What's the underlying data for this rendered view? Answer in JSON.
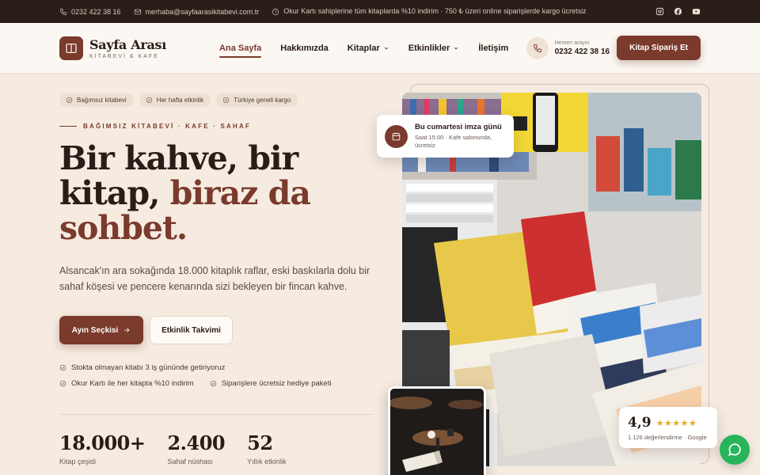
{
  "topbar": {
    "phone": "0232 422 38 16",
    "email": "merhaba@sayfaarasikitabevi.com.tr",
    "promo": "Okur Kartı sahiplerine tüm kitaplarda %10 indirim · 750 ₺ üzeri online siparişlerde kargo ücretsiz",
    "social": [
      "instagram-icon",
      "facebook-icon",
      "youtube-icon"
    ]
  },
  "header": {
    "brand_name": "Sayfa Arası",
    "brand_sub": "KİTABEVİ & KAFE",
    "nav": [
      {
        "label": "Ana Sayfa",
        "active": true
      },
      {
        "label": "Hakkımızda"
      },
      {
        "label": "Kitaplar",
        "dropdown": true
      },
      {
        "label": "Etkinlikler",
        "dropdown": true
      },
      {
        "label": "İletişim"
      }
    ],
    "call_label": "Hemen arayın",
    "call_number": "0232 422 38 16",
    "order_button": "Kitap Sipariş Et"
  },
  "hero": {
    "badges": [
      "Bağımsız kitabevi",
      "Her hafta etkinlik",
      "Türkiye geneli kargo"
    ],
    "eyebrow": "BAĞIMSIZ KİTABEVİ · KAFE · SAHAF",
    "headline_1": "Bir kahve, bir kitap,",
    "headline_accent": "biraz da sohbet.",
    "lead": "Alsancak'ın ara sokağında 18.000 kitaplık raflar, eski baskılarla dolu bir sahaf köşesi ve pencere kenarında sizi bekleyen bir fincan kahve.",
    "primary_button": "Ayın Seçkisi",
    "secondary_button": "Etkinlik Takvimi",
    "checks": [
      "Stokta olmayan kitabı 3 iş gününde getiriyoruz",
      "Okur Kartı ile her kitapta %10 indirim",
      "Siparişlere ücretsiz hediye paketi"
    ],
    "stats": [
      {
        "value": "18.000+",
        "label": "Kitap çeşidi"
      },
      {
        "value": "2.400",
        "label": "Sahaf nüshası"
      },
      {
        "value": "52",
        "label": "Yıllık etkinlik"
      }
    ]
  },
  "event_card": {
    "title": "Bu cumartesi imza günü",
    "subtitle": "Saat 15:00 · Kafe salonunda, ücretsiz"
  },
  "rating_card": {
    "value": "4,9",
    "stars": "★★★★★",
    "subtitle": "1.126 değerlendirme · Google"
  },
  "colors": {
    "accent": "#7a3a2c",
    "topbar": "#2b1d18",
    "background": "#f5ebe1",
    "whatsapp": "#27b45a",
    "stars": "#e9a823"
  }
}
